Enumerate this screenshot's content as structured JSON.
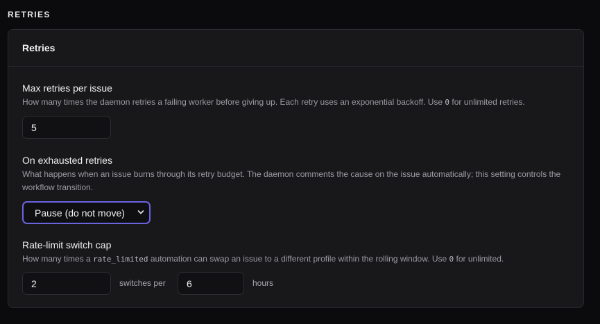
{
  "section": {
    "heading": "RETRIES"
  },
  "card": {
    "title": "Retries"
  },
  "max_retries": {
    "label": "Max retries per issue",
    "help_before": "How many times the daemon retries a failing worker before giving up. Each retry uses an exponential backoff. Use ",
    "help_code": "0",
    "help_after": " for unlimited retries.",
    "value": "5"
  },
  "exhausted": {
    "label": "On exhausted retries",
    "help": "What happens when an issue burns through its retry budget. The daemon comments the cause on the issue automatically; this setting controls the workflow transition.",
    "selected": "Pause (do not move)"
  },
  "rate_limit": {
    "label": "Rate-limit switch cap",
    "help_before": "How many times a ",
    "help_code1": "rate_limited",
    "help_middle": " automation can swap an issue to a different profile within the rolling window. Use ",
    "help_code2": "0",
    "help_after": " for unlimited.",
    "switches_value": "2",
    "switches_per_label": "switches per",
    "hours_value": "6",
    "hours_label": "hours"
  }
}
